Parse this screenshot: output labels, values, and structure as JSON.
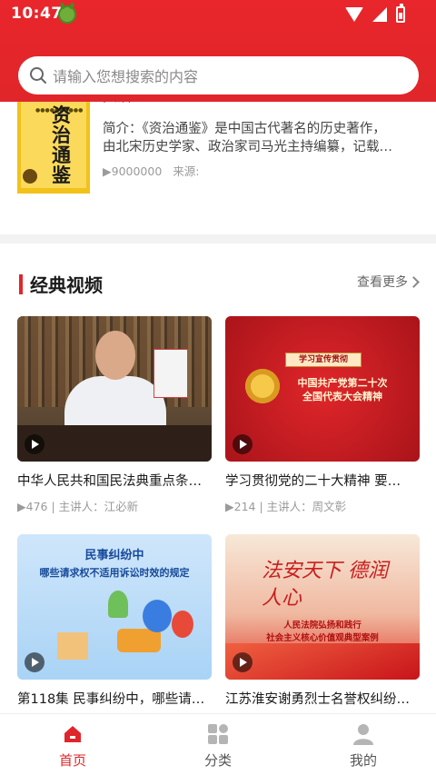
{
  "status_bar": {
    "time": "10:47"
  },
  "search": {
    "placeholder": "请输入您想搜索的内容"
  },
  "book": {
    "title": "资治通鉴",
    "cover_text": "资治通鉴",
    "desc_line1": "简介：《资治通鉴》是中国古代著名的历史著作，",
    "desc_line2": "由北宋历史学家、政治家司马光主持编纂，记载…",
    "plays": "9000000",
    "source_label": "来源:"
  },
  "videos": {
    "section_title": "经典视频",
    "more_label": "查看更多",
    "items": [
      {
        "title": "中华人民共和国民法典重点条…",
        "meta": "476 | 主讲人：江必新"
      },
      {
        "title": "学习贯彻党的二十大精神 要…",
        "meta": "214 | 主讲人：周文彰",
        "thumb_banner": "学习宣传贯彻",
        "thumb_sub": "中国共产党第二十次\n全国代表大会精神"
      },
      {
        "title": "第118集 民事纠纷中，哪些请…",
        "meta": "",
        "thumb_t1": "民事纠纷中",
        "thumb_t2": "哪些请求权不适用诉讼时效的规定"
      },
      {
        "title": "江苏淮安谢勇烈士名誉权纠纷…",
        "meta": "",
        "thumb_cal": "法安天下 德润人心",
        "thumb_sub": "人民法院弘扬和践行\n社会主义核心价值观典型案例"
      }
    ]
  },
  "nav": {
    "items": [
      {
        "label": "首页",
        "active": true
      },
      {
        "label": "分类"
      },
      {
        "label": "我的"
      }
    ]
  },
  "colors": {
    "brand_red": "#e0262a",
    "inactive_icon": "#b5b5b5"
  }
}
